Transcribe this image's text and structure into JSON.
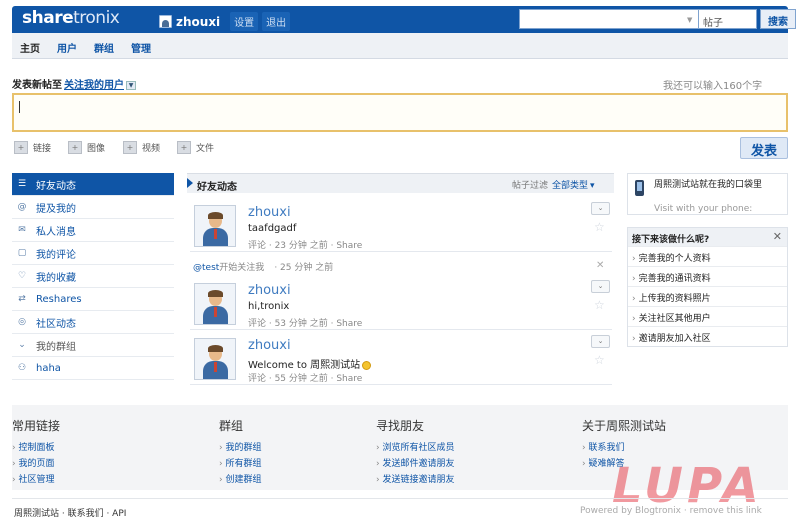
{
  "header": {
    "logo_bold": "share",
    "logo_light": "tronix",
    "username": "zhouxi",
    "settings_label": "设置",
    "logout_label": "退出",
    "search_placeholder": "",
    "search_scope": "帖子",
    "search_button": "搜索"
  },
  "nav": {
    "tabs": [
      {
        "label": "主页",
        "active": true
      },
      {
        "label": "用户"
      },
      {
        "label": "群组"
      },
      {
        "label": "管理"
      }
    ]
  },
  "composer": {
    "title": "发表新帖至",
    "target": "关注我的用户",
    "chars_left": "我还可以输入160个字",
    "attachments": [
      "链接",
      "图像",
      "视频",
      "文件"
    ],
    "post_button": "发表"
  },
  "sidebar": {
    "items": [
      {
        "label": "好友动态",
        "icon": "list-icon",
        "active": true
      },
      {
        "label": "提及我的",
        "icon": "mention-icon"
      },
      {
        "label": "私人消息",
        "icon": "mail-icon"
      },
      {
        "label": "我的评论",
        "icon": "comment-icon"
      },
      {
        "label": "我的收藏",
        "icon": "heart-icon"
      },
      {
        "label": "Reshares",
        "icon": "reshare-icon"
      },
      {
        "label": "社区动态",
        "icon": "globe-icon"
      },
      {
        "label": "我的群组",
        "icon": "chevron-down-icon",
        "group_head": true
      },
      {
        "label": "haha",
        "icon": "group-icon"
      }
    ]
  },
  "feed": {
    "title": "好友动态",
    "filter_label": "帖子过滤",
    "filter_value": "全部类型",
    "posts": [
      {
        "author": "zhouxi",
        "text": "taafdgadf",
        "meta": "评论 · 23 分钟 之前 · Share"
      },
      {
        "author": "zhouxi",
        "text": "hi,tronix",
        "meta": "评论 · 53 分钟 之前 · Share"
      },
      {
        "author": "zhouxi",
        "text": "Welcome to 周熙测试站",
        "meta": "评论 · 55 分钟 之前 · Share",
        "emoji": true
      }
    ],
    "activity": {
      "user": "@test",
      "action": "开始关注我",
      "time": "· 25 分钟 之前"
    }
  },
  "right": {
    "mobile_title": "周熙测试站就在我的口袋里",
    "mobile_sub": "Visit with your phone:",
    "todo_title": "接下来该做什么呢?",
    "todo_items": [
      "完善我的个人资料",
      "完善我的通讯资料",
      "上传我的资料照片",
      "关注社区其他用户",
      "邀请朋友加入社区"
    ]
  },
  "footer": {
    "columns": [
      {
        "title": "常用链接",
        "links": [
          "控制面板",
          "我的页面",
          "社区管理"
        ]
      },
      {
        "title": "群组",
        "links": [
          "我的群组",
          "所有群组",
          "创建群组"
        ]
      },
      {
        "title": "寻找朋友",
        "links": [
          "浏览所有社区成员",
          "发送邮件邀请朋友",
          "发送链接邀请朋友"
        ]
      },
      {
        "title": "关于周熙测试站",
        "links": [
          "联系我们",
          "疑难解答"
        ]
      }
    ],
    "bottom_left": "周熙测试站 · 联系我们 · API",
    "bottom_right": "Powered by Blogtronix · remove this link",
    "watermark": "LUPA"
  }
}
